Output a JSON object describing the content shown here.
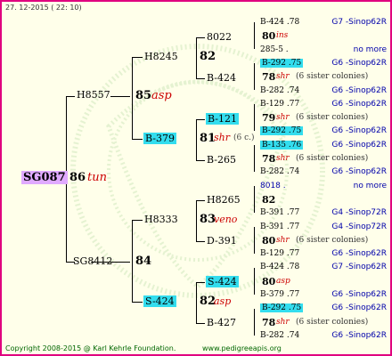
{
  "header": {
    "date": "27. 12-2015 ( 22: 10)"
  },
  "root": {
    "id": "SG087",
    "num": "86",
    "race": "tun"
  },
  "gen1": [
    {
      "id": "H8557",
      "num": "85",
      "race": "asp"
    },
    {
      "id": "SG8412",
      "num": "84",
      "race": ""
    }
  ],
  "gen2": [
    {
      "id": "H8245",
      "num": "82",
      "race": ""
    },
    {
      "id": "B-379",
      "num": "81",
      "race": "shr",
      "note": "(6 c.)"
    },
    {
      "id": "H8333",
      "num": "83",
      "race": "veno"
    },
    {
      "id": "S-424",
      "num": "82",
      "race": "asp"
    }
  ],
  "gen3": [
    {
      "id": "8022"
    },
    {
      "id": "B-424"
    },
    {
      "id": "B-121"
    },
    {
      "id": "B-265"
    },
    {
      "id": "H8265"
    },
    {
      "id": "D-391"
    },
    {
      "id": "S-424"
    },
    {
      "id": "B-427"
    }
  ],
  "gen4": [
    {
      "id": "B-424 .78",
      "tag": "G7 -Sinop62R"
    },
    {
      "num": "80",
      "race": "ins",
      "tag": ""
    },
    {
      "id": "285-5 .",
      "tag": "no more"
    },
    {
      "id": "B-292 .75",
      "tag": "G6 -Sinop62R"
    },
    {
      "num": "78",
      "race": "shr",
      "note": "(6 sister colonies)",
      "tag": ""
    },
    {
      "id": "B-282 .74",
      "tag": "G6 -Sinop62R"
    },
    {
      "id": "B-129 .77",
      "tag": "G6 -Sinop62R"
    },
    {
      "num": "79",
      "race": "shr",
      "note": "(6 sister colonies)",
      "tag": ""
    },
    {
      "id": "B-292 .75",
      "tag": "G6 -Sinop62R"
    },
    {
      "id": "B-135 .76",
      "tag": "G6 -Sinop62R"
    },
    {
      "num": "78",
      "race": "shr",
      "note": "(6 sister colonies)",
      "tag": ""
    },
    {
      "id": "B-282 .74",
      "tag": "G6 -Sinop62R"
    },
    {
      "id": "8018 .",
      "tag": "no more"
    },
    {
      "num": "82",
      "race": "",
      "tag": ""
    },
    {
      "id": "B-391 .77",
      "tag": "G4 -Sinop72R"
    },
    {
      "id": "B-391 .77",
      "tag": "G4 -Sinop72R"
    },
    {
      "num": "80",
      "race": "shr",
      "note": "(6 sister colonies)",
      "tag": ""
    },
    {
      "id": "B-129 .77",
      "tag": "G6 -Sinop62R"
    },
    {
      "id": "B-424 .78",
      "tag": "G7 -Sinop62R"
    },
    {
      "num": "80",
      "race": "asp",
      "tag": ""
    },
    {
      "id": "B-379 .77",
      "tag": "G6 -Sinop62R"
    },
    {
      "id": "B-292 .75",
      "tag": "G6 -Sinop62R"
    },
    {
      "num": "78",
      "race": "shr",
      "note": "(6 sister colonies)",
      "tag": ""
    },
    {
      "id": "B-282 .74",
      "tag": "G6 -Sinop62R"
    }
  ],
  "footer": {
    "copyright": "Copyright 2008-2015 @ Karl Kehrle Foundation.",
    "url": "www.pedigreeapis.org"
  },
  "colors": {
    "border": "#e0007f",
    "highlight": "#33ddee",
    "root_bg": "#e0aaff",
    "race": "#cc0000",
    "tag": "#0000aa"
  }
}
